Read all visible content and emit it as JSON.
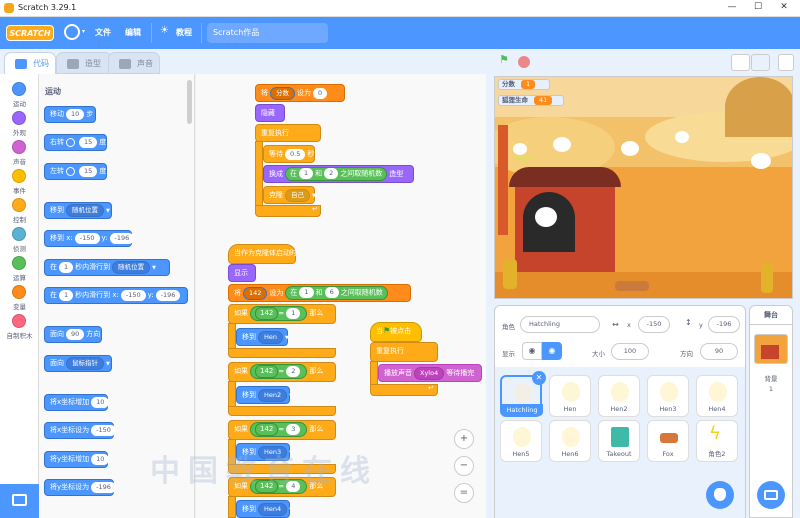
{
  "window": {
    "title": "Scratch 3.29.1",
    "controls": [
      "—",
      "☐",
      "✕"
    ]
  },
  "menu": {
    "logo": "SCRATCH",
    "file": "文件",
    "edit": "编辑",
    "tutorials": "教程",
    "project_name": "Scratch作品"
  },
  "tabs": {
    "code": "代码",
    "costumes": "造型",
    "sounds": "声音"
  },
  "categories": [
    {
      "label": "运动",
      "color": "#4c97ff"
    },
    {
      "label": "外观",
      "color": "#9966ff"
    },
    {
      "label": "声音",
      "color": "#cf63cf"
    },
    {
      "label": "事件",
      "color": "#ffbf00"
    },
    {
      "label": "控制",
      "color": "#ffab19"
    },
    {
      "label": "侦测",
      "color": "#5cb1d6"
    },
    {
      "label": "运算",
      "color": "#59c059"
    },
    {
      "label": "变量",
      "color": "#ff8c1a"
    },
    {
      "label": "自制积木",
      "color": "#ff6680"
    }
  ],
  "palette": {
    "heading": "运动",
    "move": "移动",
    "move_val": "10",
    "move_unit": "步",
    "turn_right": "右转",
    "turn_left": "左转",
    "turn_val": "15",
    "turn_unit": "度",
    "goto": "移到",
    "goto_target": "随机位置",
    "goto_xy": "移到 x:",
    "x_val": "-150",
    "y_label": "y:",
    "y_val": "-196",
    "glide_prefix": "在",
    "glide_secs": "1",
    "glide_mid": "秒内滑行到",
    "glide_target": "随机位置",
    "glide_xy_mid": "秒内滑行到 x:",
    "point_dir": "面向",
    "dir_val": "90",
    "dir_unit": "方向",
    "point_towards": "面向",
    "towards_target": "鼠标指针",
    "change_x": "将x坐标增加",
    "change_x_val": "10",
    "set_x": "将x坐标设为",
    "set_x_val": "-150",
    "change_y": "将y坐标增加",
    "change_y_val": "10",
    "set_y": "将y坐标设为",
    "set_y_val": "-196"
  },
  "script1": {
    "set_prefix": "将",
    "set_var": "分数",
    "set_mid": "设为",
    "set_val": "0",
    "hide": "隐藏",
    "forever": "重复执行",
    "wait": "等待",
    "wait_val": "0.5",
    "wait_unit": "秒",
    "switch": "换成",
    "switch_mid": "在",
    "switch_a": "1",
    "switch_and": "和",
    "switch_b": "2",
    "switch_op": "之间取随机数",
    "switch_unit": "造型",
    "clone": "克隆",
    "clone_target": "自己"
  },
  "script2": {
    "hat": "当作为克隆体启动时",
    "show": "显示",
    "set_prefix": "将",
    "set_var": "142",
    "set_mid": "设为",
    "set_in": "在",
    "rand_a": "1",
    "rand_and": "和",
    "rand_b": "6",
    "rand_op": "之间取随机数",
    "ifs": [
      {
        "if": "如果",
        "var": "142",
        "eq": "=",
        "val": "1",
        "then": "那么",
        "goto": "移到",
        "target": "Hen"
      },
      {
        "if": "如果",
        "var": "142",
        "eq": "=",
        "val": "2",
        "then": "那么",
        "goto": "移到",
        "target": "Hen2"
      },
      {
        "if": "如果",
        "var": "142",
        "eq": "=",
        "val": "3",
        "then": "那么",
        "goto": "移到",
        "target": "Hen3"
      },
      {
        "if": "如果",
        "var": "142",
        "eq": "=",
        "val": "4",
        "then": "那么",
        "goto": "移到",
        "target": "Hen4"
      }
    ]
  },
  "script3": {
    "hat_prefix": "当",
    "hat_suffix": "被点击",
    "forever": "重复执行",
    "play": "播放声音",
    "sound": "Xylo4",
    "play_suffix": "等待播完"
  },
  "zoom": {
    "in": "+",
    "out": "−",
    "reset": "="
  },
  "stage_monitors": [
    {
      "label": "分数",
      "value": "1"
    },
    {
      "label": "狐狸生命",
      "value": "41"
    }
  ],
  "sprite_info": {
    "sprite_label": "角色",
    "sprite_name": "Hatchling",
    "x_label": "x",
    "x_val": "-150",
    "y_label": "y",
    "y_val": "-196",
    "show_label": "显示",
    "size_label": "大小",
    "size_val": "100",
    "dir_label": "方向",
    "dir_val": "90"
  },
  "sprites": [
    {
      "name": "Hatchling",
      "selected": true
    },
    {
      "name": "Hen"
    },
    {
      "name": "Hen2"
    },
    {
      "name": "Hen3"
    },
    {
      "name": "Hen4"
    },
    {
      "name": "Hen5"
    },
    {
      "name": "Hen6"
    },
    {
      "name": "Takeout"
    },
    {
      "name": "Fox"
    },
    {
      "name": "角色2"
    }
  ],
  "stage_panel": {
    "title": "舞台",
    "backdrop_label": "背景",
    "backdrop_count": "1"
  },
  "watermark": "中国教育在线"
}
